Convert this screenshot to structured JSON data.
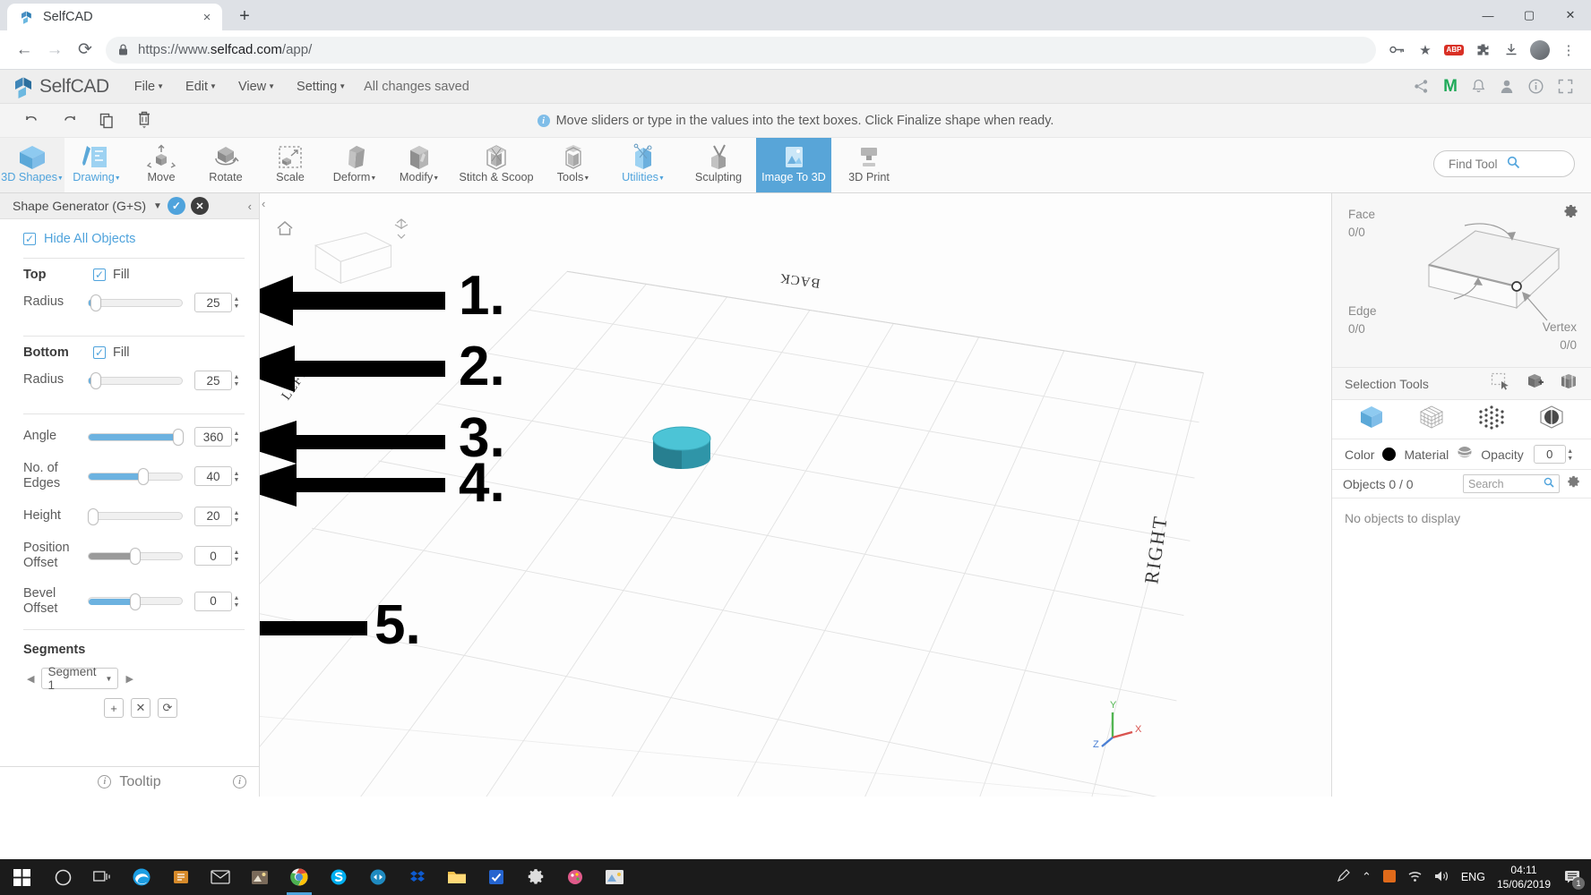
{
  "browser": {
    "tab": {
      "title": "SelfCAD",
      "favicon": "selfcad-logo-icon",
      "close": "×"
    },
    "newtab_label": "+",
    "nav": {
      "back": "←",
      "forward": "→",
      "reload": "⟳"
    },
    "omnibox": {
      "lock": "lock-icon",
      "url_prefix": "https://www.",
      "url_domain": "selfcad.com",
      "url_path": "/app/"
    },
    "toolbar_right": {
      "key_icon": "key-icon",
      "star_icon": "★",
      "ext_badge": "ABP",
      "puzzle_icon": "puzzle-icon",
      "download_icon": "↓",
      "menu_icon": "⋮"
    },
    "window_controls": {
      "minimize": "—",
      "maximize": "▢",
      "close": "✕"
    }
  },
  "app": {
    "logo_text": "SelfCAD",
    "menus": [
      {
        "label": "File",
        "caret": "▼"
      },
      {
        "label": "Edit",
        "caret": "▼"
      },
      {
        "label": "View",
        "caret": "▼"
      },
      {
        "label": "Setting",
        "caret": "▼"
      }
    ],
    "save_status": "All changes saved",
    "menubar_icons": [
      "share-icon",
      "gmail-icon",
      "bell-icon",
      "user-icon",
      "info-icon",
      "fullscreen-icon"
    ],
    "action_icons": [
      "undo-icon",
      "redo-icon",
      "copy-icon",
      "delete-icon"
    ],
    "notification": {
      "icon": "info-icon",
      "text": "Move sliders or type in the values into the text boxes. Click Finalize shape when ready."
    },
    "toolbar": [
      {
        "label": "3D Shapes",
        "caret": "▼",
        "icon": "cube-icon",
        "state": "active-grey",
        "accent": "blue"
      },
      {
        "label": "Drawing",
        "caret": "▼",
        "icon": "drawing-icon",
        "state": "",
        "accent": "blue"
      },
      {
        "label": "Move",
        "caret": "",
        "icon": "move-icon",
        "state": "",
        "accent": ""
      },
      {
        "label": "Rotate",
        "caret": "",
        "icon": "rotate-icon",
        "state": "",
        "accent": ""
      },
      {
        "label": "Scale",
        "caret": "",
        "icon": "scale-icon",
        "state": "",
        "accent": ""
      },
      {
        "label": "Deform",
        "caret": "▼",
        "icon": "deform-icon",
        "state": "",
        "accent": ""
      },
      {
        "label": "Modify",
        "caret": "▼",
        "icon": "modify-icon",
        "state": "",
        "accent": ""
      },
      {
        "label": "Stitch & Scoop",
        "caret": "",
        "icon": "stitch-scoop-icon",
        "state": "",
        "accent": ""
      },
      {
        "label": "Tools",
        "caret": "▼",
        "icon": "tools-icon",
        "state": "",
        "accent": ""
      },
      {
        "label": "Utilities",
        "caret": "▼",
        "icon": "utilities-icon",
        "state": "",
        "accent": "blue"
      },
      {
        "label": "Sculpting",
        "caret": "",
        "icon": "sculpting-icon",
        "state": "",
        "accent": ""
      },
      {
        "label": "Image To 3D",
        "caret": "",
        "icon": "image-to-3d-icon",
        "state": "active-blue",
        "accent": ""
      },
      {
        "label": "3D Print",
        "caret": "",
        "icon": "3d-print-icon",
        "state": "",
        "accent": ""
      }
    ],
    "find_tool": {
      "placeholder": "Find Tool",
      "icon": "search-icon"
    }
  },
  "left_panel": {
    "title": "Shape Generator (G+S)",
    "caret": "▼",
    "confirm_icon": "✓",
    "cancel_icon": "✕",
    "collapse_icon": "‹",
    "hide_all_objects": {
      "label": "Hide All Objects",
      "checked": true
    },
    "groups": [
      {
        "title": "Top",
        "fill_label": "Fill",
        "fill_checked": true,
        "rows": [
          {
            "label": "Radius",
            "value": "25",
            "fill_pct": 4,
            "knob_pct": 5,
            "fill_color": "blue"
          }
        ]
      },
      {
        "title": "Bottom",
        "fill_label": "Fill",
        "fill_checked": true,
        "rows": [
          {
            "label": "Radius",
            "value": "25",
            "fill_pct": 4,
            "knob_pct": 5,
            "fill_color": "blue"
          }
        ]
      }
    ],
    "params": [
      {
        "label": "Angle",
        "value": "360",
        "fill_pct": 94,
        "knob_pct": 94,
        "fill_color": "blue"
      },
      {
        "label": "No. of Edges",
        "value": "40",
        "fill_pct": 56,
        "knob_pct": 56,
        "fill_color": "blue"
      },
      {
        "label": "Height",
        "value": "20",
        "fill_pct": 0,
        "knob_pct": 2,
        "fill_color": "blue"
      },
      {
        "label": "Position Offset",
        "value": "0",
        "fill_pct": 46,
        "knob_pct": 47,
        "fill_color": "grey"
      },
      {
        "label": "Bevel Offset",
        "value": "0",
        "fill_pct": 46,
        "knob_pct": 47,
        "fill_color": "blue"
      }
    ],
    "segments": {
      "title": "Segments",
      "prev": "◀",
      "next": "▶",
      "selected": "Segment 1",
      "select_caret": "▼",
      "buttons": [
        "+",
        "✕",
        "⟳"
      ]
    },
    "footer": {
      "label": "Tooltip",
      "icon": "info-icon",
      "info_icon": "info-icon"
    }
  },
  "viewport": {
    "home_icon": "home-icon",
    "pan_icon": "pan-icon",
    "orbit_icon": "orbit-icon",
    "axis_labels": [
      {
        "text": "BACK",
        "name": "viewport-label-back"
      },
      {
        "text": "LEFT",
        "name": "viewport-label-left"
      },
      {
        "text": "RIGHT",
        "name": "viewport-label-right"
      }
    ],
    "gizmo": {
      "x": "X",
      "y": "Y",
      "z": "Z"
    },
    "object_color": "#3fb3c8"
  },
  "annotations": [
    {
      "num": "1."
    },
    {
      "num": "2."
    },
    {
      "num": "3."
    },
    {
      "num": "4."
    },
    {
      "num": "5."
    }
  ],
  "right_panel": {
    "gear_icon": "gear-icon",
    "counters": [
      {
        "label": "Face",
        "value": "0/0"
      },
      {
        "label": "Edge",
        "value": "0/0"
      },
      {
        "label": "Vertex",
        "value": "0/0"
      }
    ],
    "selection_tools": {
      "label": "Selection Tools",
      "icons": [
        "rect-select-icon",
        "add-select-icon",
        "multi-select-icon"
      ]
    },
    "modes": [
      "object-mode-icon",
      "wireframe-mode-icon",
      "vertex-mode-icon",
      "sphere-mode-icon"
    ],
    "color": {
      "label": "Color",
      "swatch": "#000000"
    },
    "material": {
      "label": "Material",
      "icon": "material-icon"
    },
    "opacity": {
      "label": "Opacity",
      "value": "0"
    },
    "objects": {
      "label": "Objects 0 / 0",
      "search_placeholder": "Search",
      "search_icon": "search-icon",
      "gear_icon": "gear-icon"
    },
    "empty_message": "No objects to display"
  },
  "taskbar": {
    "start_icon": "windows-start-icon",
    "items": [
      "cortana-icon",
      "taskview-icon",
      "edge-icon",
      "store-icon",
      "mail-icon",
      "photos-app-icon",
      "chrome-icon",
      "skype-icon",
      "teamviewer-icon",
      "dropbox-icon",
      "explorer-icon",
      "todo-icon",
      "settings-icon",
      "paint-icon",
      "gallery-icon"
    ],
    "tray": {
      "pen_icon": "pen-icon",
      "chevron_up": "⌃",
      "orange_icon": "app-icon",
      "wifi_icon": "wifi-icon",
      "volume_icon": "volume-icon",
      "language": "ENG",
      "time": "04:11",
      "date": "15/06/2019",
      "notif_icon": "notification-icon",
      "notif_count": "1"
    }
  }
}
